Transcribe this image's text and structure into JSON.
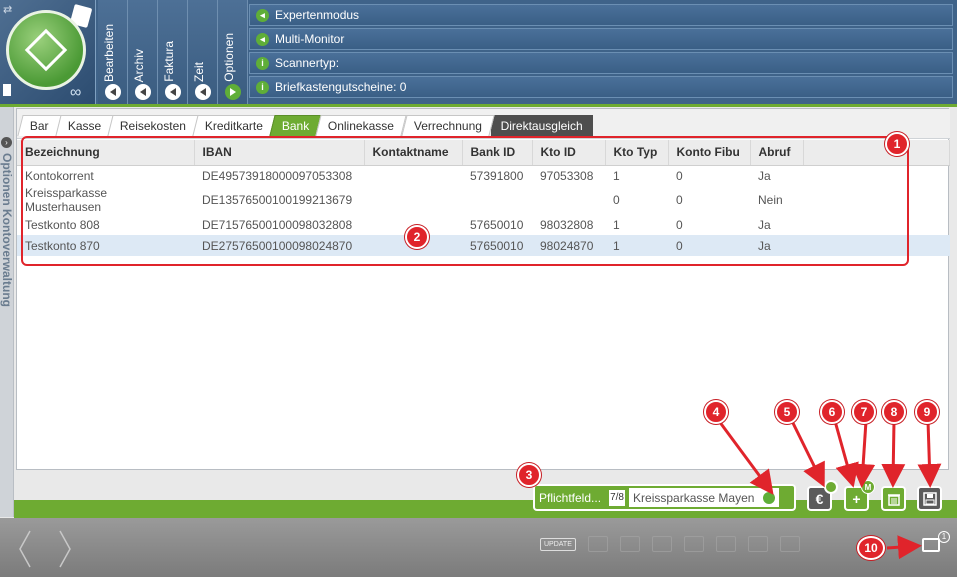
{
  "sidebar_vertical_tabs": [
    {
      "label": "Bearbeiten"
    },
    {
      "label": "Archiv"
    },
    {
      "label": "Faktura"
    },
    {
      "label": "Zeit"
    },
    {
      "label": "Optionen"
    }
  ],
  "menu_items": [
    {
      "label": "Expertenmodus",
      "icon": "arrow-right"
    },
    {
      "label": "Multi-Monitor",
      "icon": "arrow-right"
    },
    {
      "label": "Scannertyp:",
      "icon": "info"
    },
    {
      "label": "Briefkastengutscheine: 0",
      "icon": "info"
    }
  ],
  "side_panel": {
    "label": "Optionen  Kontoverwaltung"
  },
  "tabs": [
    {
      "label": "Bar"
    },
    {
      "label": "Kasse"
    },
    {
      "label": "Reisekosten"
    },
    {
      "label": "Kreditkarte"
    },
    {
      "label": "Bank",
      "active": true
    },
    {
      "label": "Onlinekasse"
    },
    {
      "label": "Verrechnung"
    },
    {
      "label": "Direktausgleich"
    }
  ],
  "table": {
    "columns": [
      "Bezeichnung",
      "IBAN",
      "Kontaktname",
      "Bank ID",
      "Kto ID",
      "Kto Typ",
      "Konto Fibu",
      "Abruf"
    ],
    "rows": [
      [
        "Kontokorrent",
        "DE49573918000097053308",
        "",
        "57391800",
        "97053308",
        "1",
        "0",
        "Ja"
      ],
      [
        "Kreissparkasse Musterhausen",
        "DE13576500100199213679",
        "",
        "",
        "",
        "0",
        "0",
        "Nein"
      ],
      [
        "Testkonto 808",
        "DE71576500100098032808",
        "",
        "57650010",
        "98032808",
        "1",
        "0",
        "Ja"
      ],
      [
        "Testkonto 870",
        "DE27576500100098024870",
        "",
        "57650010",
        "98024870",
        "1",
        "0",
        "Ja"
      ]
    ],
    "selected_row": 3
  },
  "mandatory_field": {
    "label": "Pflichtfeld...",
    "picto": "7/8",
    "value": "Kreissparkasse Mayen"
  },
  "toolbar": {
    "currency_symbol": "€",
    "add_symbol": "+",
    "badge_m": "M"
  },
  "footer": {
    "update_label": "UPDATE",
    "mail_badge": "1"
  },
  "markers": [
    "1",
    "2",
    "3",
    "4",
    "5",
    "6",
    "7",
    "8",
    "9",
    "10"
  ],
  "colors": {
    "header_blue": "#3f6389",
    "accent_green": "#6eab32",
    "marker_red": "#e0242b"
  }
}
